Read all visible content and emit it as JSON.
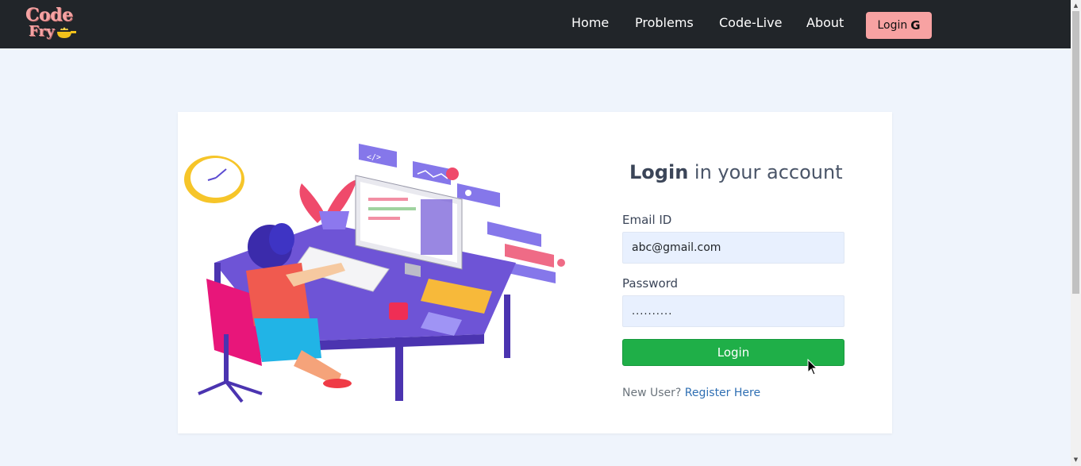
{
  "brand": {
    "line1": "Code",
    "line2": "Fry"
  },
  "nav": {
    "home": "Home",
    "problems": "Problems",
    "code_live": "Code-Live",
    "about": "About",
    "login": "Login",
    "login_icon": "G"
  },
  "form": {
    "title_bold": "Login",
    "title_rest": " in your account",
    "email_label": "Email ID",
    "email_value": "abc@gmail.com",
    "password_label": "Password",
    "password_value": "..........",
    "submit_label": "Login",
    "register_prompt": "New User? ",
    "register_link": "Register Here"
  },
  "colors": {
    "navbar": "#212529",
    "login_button": "#f7a2a2",
    "submit_button": "#1faf48",
    "page_background": "#eff4fc",
    "link": "#2f6fb3"
  },
  "icons": {
    "logo": "code-fry-logo",
    "google": "google-g-icon",
    "cursor": "mouse-pointer-icon",
    "illustration": "developer-at-desk-illustration"
  }
}
